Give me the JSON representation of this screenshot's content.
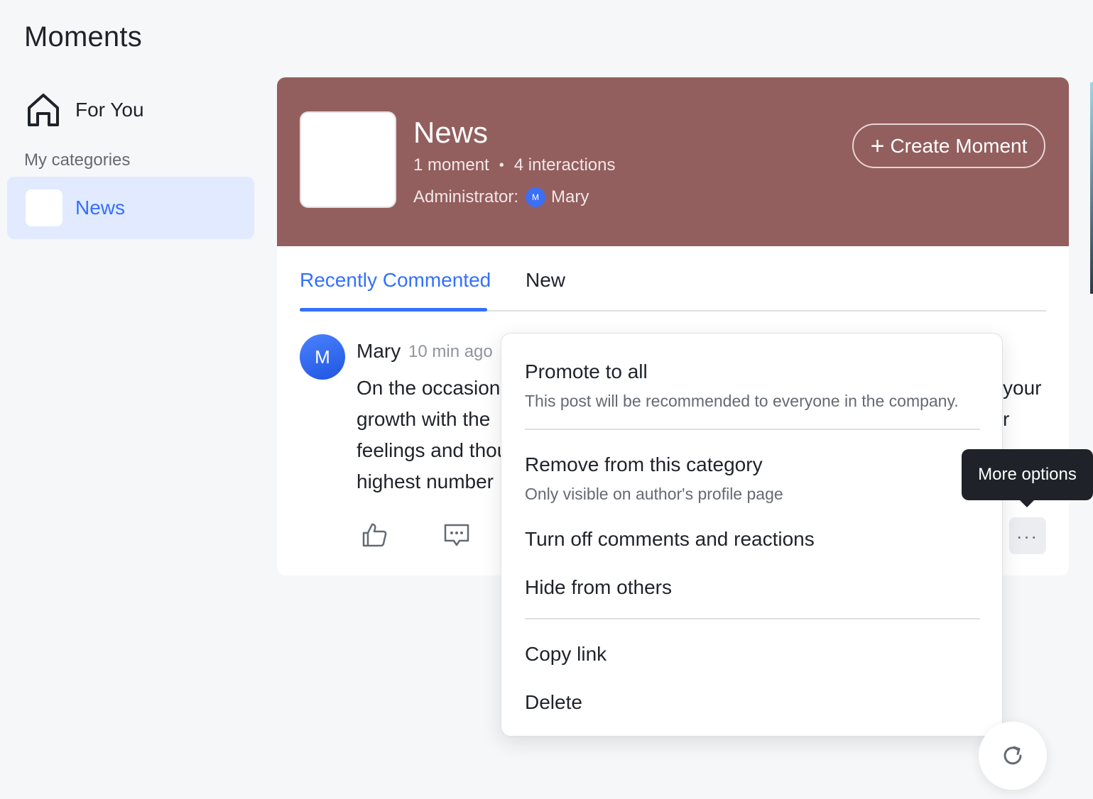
{
  "app": {
    "title": "Moments"
  },
  "sidebar": {
    "for_you": {
      "label": "For You",
      "icon": "home-icon"
    },
    "categories_heading": "My categories",
    "categories": [
      {
        "label": "News",
        "selected": true
      }
    ]
  },
  "category": {
    "title": "News",
    "moments": "1 moment",
    "separator": "•",
    "interactions": "4 interactions",
    "admin_label": "Administrator:",
    "admin_initial": "M",
    "admin_name": "Mary",
    "create_plus": "+",
    "create_label": "Create Moment",
    "banner_color": "#925f5e"
  },
  "tabs": [
    {
      "label": "Recently Commented",
      "active": true
    },
    {
      "label": "New",
      "active": false
    }
  ],
  "post": {
    "avatar_initial": "M",
    "author": "Mary",
    "time": "10 min ago",
    "lines": [
      "On the occasion",
      "growth with the",
      "feelings and thou",
      "highest number"
    ],
    "right_fragments": [
      "your",
      "r"
    ],
    "more_dots": "..."
  },
  "menu": {
    "items": [
      {
        "title": "Promote to all",
        "subtitle": "This post will be recommended to everyone in the company."
      },
      {
        "title": "Remove from this category",
        "subtitle": "Only visible on author's profile page"
      },
      {
        "title": "Turn off comments and reactions"
      },
      {
        "title": "Hide from others"
      },
      {
        "title": "Copy link"
      },
      {
        "title": "Delete"
      }
    ]
  },
  "tooltip": {
    "text": "More options"
  },
  "colors": {
    "accent": "#3370ff",
    "selected_bg": "#e1eaff",
    "text": "#1f2329",
    "muted": "#646a73"
  }
}
